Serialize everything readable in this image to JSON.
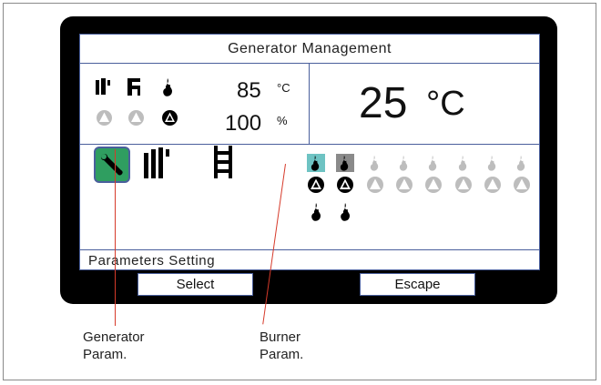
{
  "header": {
    "title": "Generator Management"
  },
  "status": {
    "temperature_value": "85",
    "temperature_unit": "°C",
    "power_value": "100",
    "power_unit": "%"
  },
  "main_display": {
    "value": "25",
    "unit": "°C"
  },
  "footer": {
    "label": "Parameters Setting"
  },
  "softkeys": {
    "select_label": "Select",
    "escape_label": "Escape"
  },
  "callouts": {
    "generator_line1": "Generator",
    "generator_line2": "Param.",
    "burner_line1": "Burner",
    "burner_line2": "Param."
  },
  "burners": {
    "count": 8,
    "active_in_top_row": [
      0,
      1
    ],
    "flame_below": [
      0,
      1
    ]
  },
  "colors": {
    "accent_border": "#4a5f9c",
    "selected_green": "#2f9e60",
    "burner_teal": "#6ec3c3",
    "callout_red": "#d63a2a"
  }
}
